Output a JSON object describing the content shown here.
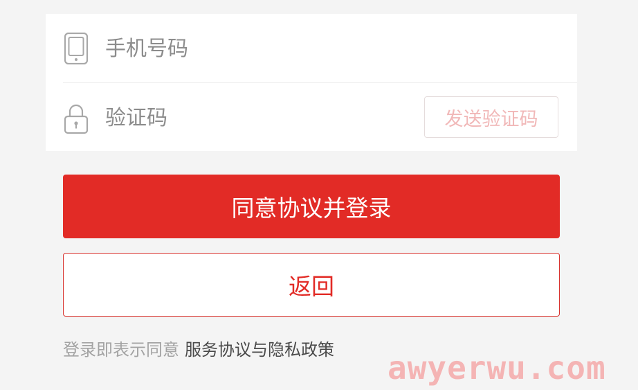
{
  "form": {
    "phone": {
      "icon": "mobile-phone-icon",
      "placeholder": "手机号码"
    },
    "code": {
      "icon": "padlock-icon",
      "placeholder": "验证码",
      "send_code_label": "发送验证码"
    }
  },
  "actions": {
    "login_label": "同意协议并登录",
    "back_label": "返回"
  },
  "agreement": {
    "prefix": "登录即表示同意",
    "link_label": "服务协议与隐私政策"
  },
  "watermark": "awyerwu.com",
  "colors": {
    "primary": "#e22b26",
    "background": "#f4f4f4",
    "placeholder_text": "#8c8c8c",
    "disabled_send_text": "#f1b8b8",
    "agreement_link_text": "#4a4a4a"
  }
}
